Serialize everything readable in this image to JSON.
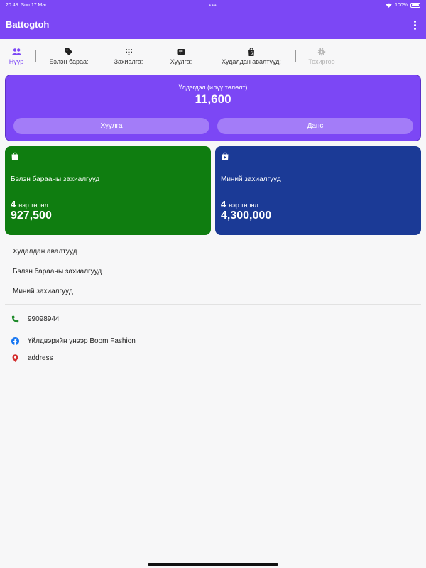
{
  "status_bar": {
    "time": "20:48",
    "date": "Sun 17 Mar",
    "battery": "100%"
  },
  "app": {
    "title": "Battogtoh"
  },
  "tabs": [
    {
      "label": "Нүүр",
      "icon": "people-icon",
      "state": "active"
    },
    {
      "label": "Бэлэн бараа:",
      "icon": "tag-icon",
      "state": "normal"
    },
    {
      "label": "Захиалга:",
      "icon": "dialpad-icon",
      "state": "normal"
    },
    {
      "label": "Хуулга:",
      "icon": "transfer-icon",
      "state": "normal"
    },
    {
      "label": "Худалдан авалтууд:",
      "icon": "shop-icon",
      "state": "normal"
    },
    {
      "label": "Тохиргоо",
      "icon": "gear-icon",
      "state": "disabled"
    }
  ],
  "balance": {
    "label": "Үлдэгдэл (илүү төлөлт)",
    "value": "11,600",
    "left_button": "Хуулга",
    "right_button": "Данс"
  },
  "cards": [
    {
      "title": "Бэлэн барааны захиалгууд",
      "count": "4",
      "count_label": "нэр төрөл",
      "total": "927,500",
      "color": "#0f7d10"
    },
    {
      "title": "Миний захиалгууд",
      "count": "4",
      "count_label": "нэр төрөл",
      "total": "4,300,000",
      "color": "#1b3a96"
    }
  ],
  "links": [
    "Худалдан авалтууд",
    "Бэлэн барааны захиалгууд",
    "Миний захиалгууд"
  ],
  "contacts": {
    "phone": "99098944",
    "facebook": "Үйлдвэрийн үнээр Boom Fashion",
    "address": "address"
  },
  "colors": {
    "accent": "#7c47f5",
    "green": "#0f7d10",
    "blue": "#1b3a96",
    "phone": "#1e8a2a",
    "facebook": "#1877f2",
    "location": "#d32f2f"
  }
}
